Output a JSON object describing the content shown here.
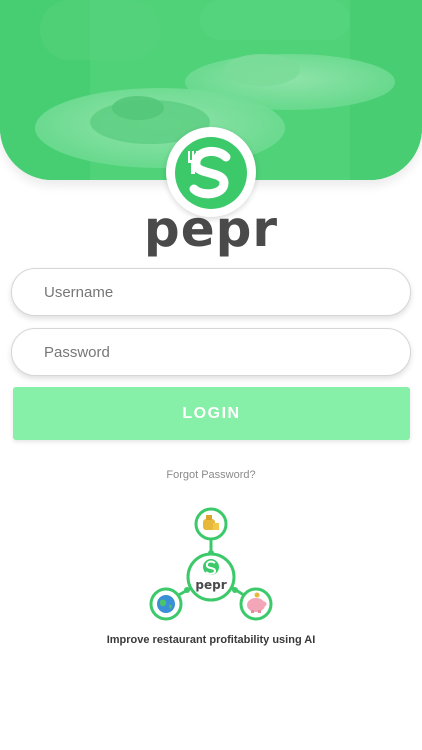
{
  "colors": {
    "brand_green": "#3cc96a",
    "login_button": "#86efa8",
    "brand_text": "#4a4a4a"
  },
  "header": {
    "image": "restaurant-plates-photo",
    "logo_icon": "pepr-fork-s-logo-icon"
  },
  "brand": {
    "name": "pepr"
  },
  "login_form": {
    "username_placeholder": "Username",
    "password_placeholder": "Password",
    "login_label": "LOGIN",
    "forgot_label": "Forgot Password?"
  },
  "illustration": {
    "center_label": "pepr",
    "icons": [
      "money-bag-icon",
      "globe-icon",
      "piggy-bank-icon"
    ]
  },
  "tagline": "Improve restaurant profitability using AI"
}
